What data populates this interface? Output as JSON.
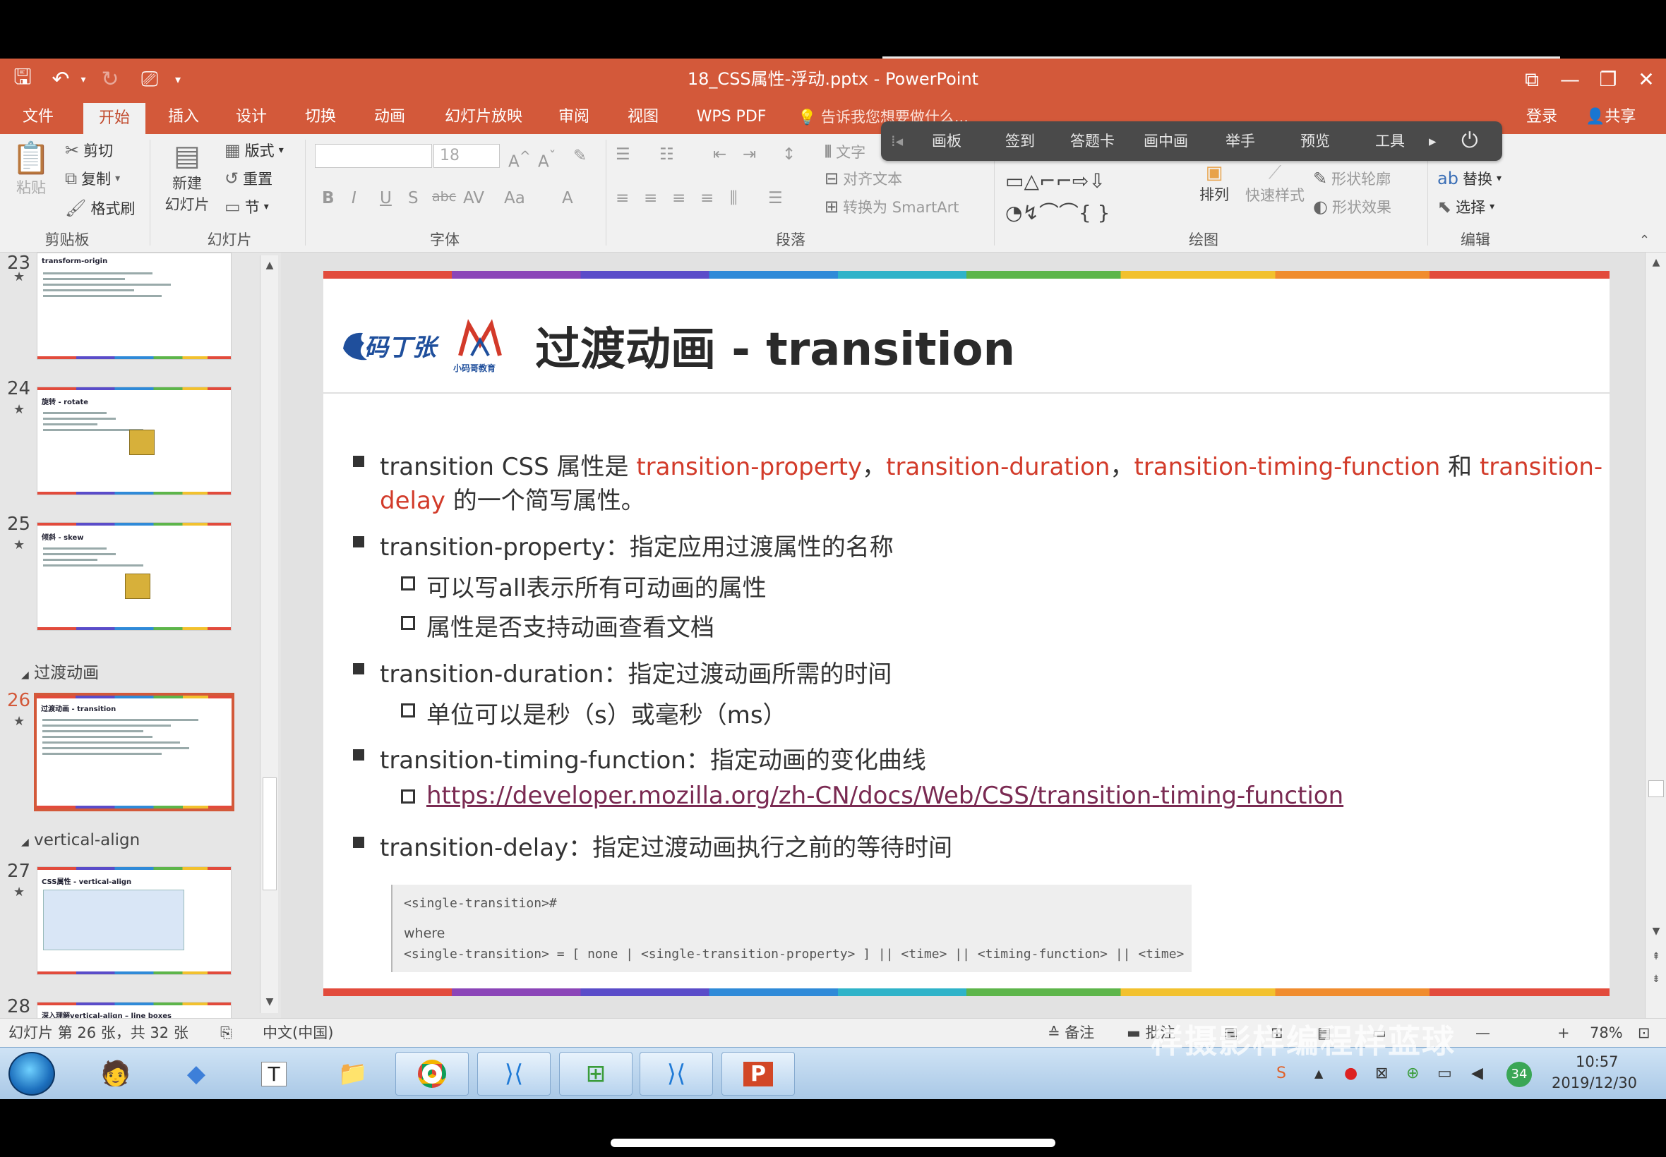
{
  "window": {
    "title": "18_CSS属性-浮动.pptx - PowerPoint",
    "controls": [
      "⧉",
      "—",
      "❐",
      "✕"
    ]
  },
  "quick_access": {
    "save_icon": "save-icon",
    "undo_icon": "undo-icon",
    "redo_icon": "redo-icon",
    "slideshow_icon": "present-icon"
  },
  "tabs": [
    "文件",
    "开始",
    "插入",
    "设计",
    "切换",
    "动画",
    "幻灯片放映",
    "审阅",
    "视图",
    "WPS PDF"
  ],
  "active_tab": "开始",
  "tell_me": "告诉我您想要做什么...",
  "login": "登录",
  "share": "共享",
  "ribbon": {
    "clipboard": {
      "paste": "粘贴",
      "cut": "剪切",
      "copy": "复制",
      "format_painter": "格式刷",
      "group": "剪贴板"
    },
    "slides": {
      "new_slide_1": "新建",
      "new_slide_2": "幻灯片",
      "layout": "版式",
      "reset": "重置",
      "section": "节",
      "group": "幻灯片"
    },
    "font": {
      "size": "18",
      "group": "字体"
    },
    "paragraph": {
      "text_dir": "文字",
      "align_text": "对齐文本",
      "smartart": "转换为 SmartArt",
      "group": "段落"
    },
    "drawing": {
      "arrange": "排列",
      "quick_styles": "快速样式",
      "outline": "形状轮廓",
      "effects": "形状效果",
      "group": "绘图"
    },
    "editing": {
      "replace": "替换",
      "select": "选择",
      "group": "编辑"
    }
  },
  "float_toolbar": [
    "画板",
    "签到",
    "答题卡",
    "画中画",
    "举手",
    "预览",
    "工具"
  ],
  "thumbnails": [
    {
      "num": "23",
      "title": "transform-origin"
    },
    {
      "num": "24",
      "title": "旋转 - rotate"
    },
    {
      "num": "25",
      "title": "倾斜 - skew"
    },
    {
      "num": "26",
      "title": "过渡动画 - transition"
    },
    {
      "num": "27",
      "title": "CSS属性 - vertical-align"
    },
    {
      "num": "28",
      "title": "深入理解vertical-align – line boxes"
    }
  ],
  "sections": {
    "s1": "过渡动画",
    "s2": "vertical-align"
  },
  "slide": {
    "title": "过渡动画 - transition",
    "logo_text_1": "码丁张",
    "logo_text_2": "小码哥教育",
    "bullets": {
      "b1_a": "transition CSS 属性是 ",
      "b1_r1": "transition-property",
      "b1_c1": "，",
      "b1_r2": "transition-duration",
      "b1_c2": "，",
      "b1_r3": "transition-timing-function",
      "b1_and": " 和 ",
      "b1_r4": "transition-",
      "b1_r5": "delay",
      "b1_tail": " 的一个简写属性。",
      "b2": "transition-property：指定应用过渡属性的名称",
      "b2_s1": "可以写all表示所有可动画的属性",
      "b2_s2": "属性是否支持动画查看文档",
      "b3": "transition-duration：指定过渡动画所需的时间",
      "b3_s1": "单位可以是秒（s）或毫秒（ms）",
      "b4": "transition-timing-function：指定动画的变化曲线",
      "b4_link": "https://developer.mozilla.org/zh-CN/docs/Web/CSS/transition-timing-function",
      "b5": "transition-delay：指定过渡动画执行之前的等待时间"
    },
    "code": {
      "line1": "<single-transition>#",
      "line2": "where",
      "line3": "<single-transition> = [ none | <single-transition-property> ] || <time> || <timing-function> || <time>"
    }
  },
  "status": {
    "slide_info": "幻灯片 第 26 张，共 32 张",
    "language": "中文(中国)",
    "notes": "备注",
    "comments": "批注",
    "zoom": "78%"
  },
  "taskbar": {
    "time": "10:57",
    "date": "2019/12/30",
    "badge": "34"
  },
  "watermark": "样摄影样编程样蓝球"
}
